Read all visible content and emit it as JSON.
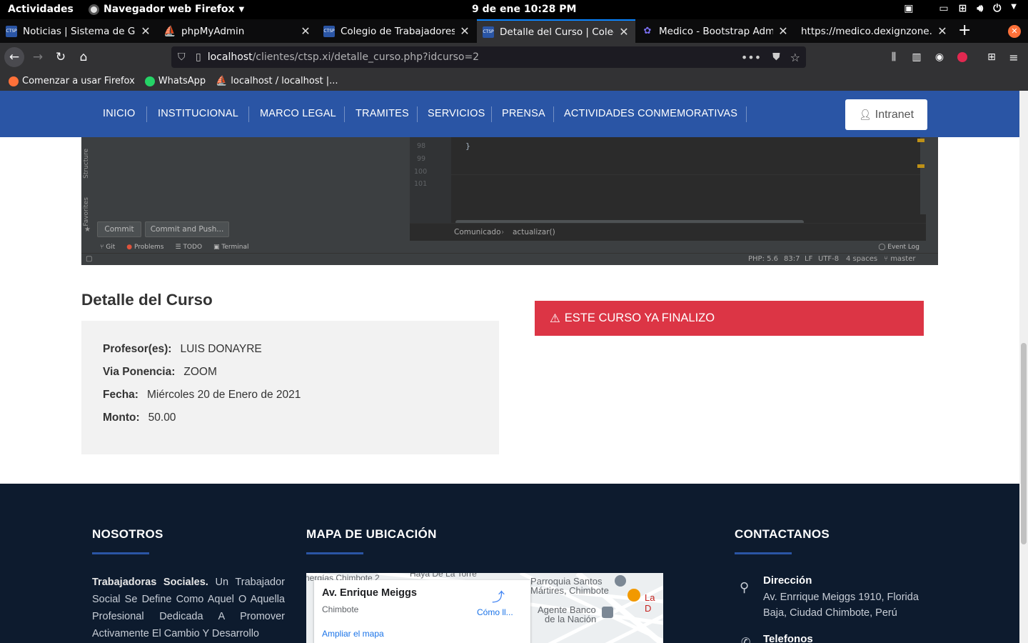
{
  "gnome": {
    "activities": "Actividades",
    "app_name": "Navegador web Firefox",
    "clock": "9 de ene  10:28 PM"
  },
  "tabs": [
    {
      "label": "Noticias | Sistema de Gesti",
      "favicon": "CTSP"
    },
    {
      "label": "phpMyAdmin",
      "favicon": "PMA"
    },
    {
      "label": "Colegio de Trabajadores So",
      "favicon": "CTSP"
    },
    {
      "label": "Detalle del Curso | Colegio",
      "favicon": "CTSP"
    },
    {
      "label": "Medico - Bootstrap Admin",
      "favicon": "DZ"
    },
    {
      "label": "https://medico.dexignzone.co",
      "favicon": ""
    }
  ],
  "url": {
    "host": "localhost",
    "path": "/clientes/ctsp.xi/detalle_curso.php?idcurso=2"
  },
  "bookmarks": [
    {
      "label": "Comenzar a usar Firefox"
    },
    {
      "label": "WhatsApp"
    },
    {
      "label": "localhost / localhost |..."
    }
  ],
  "site_nav": {
    "items": [
      "INICIO",
      "INSTITUCIONAL",
      "MARCO LEGAL",
      "TRAMITES",
      "SERVICIOS",
      "PRENSA",
      "ACTIVIDADES CONMEMORATIVAS"
    ],
    "intranet": "Intranet"
  },
  "ide": {
    "line_numbers": [
      "98",
      "99",
      "100",
      "101"
    ],
    "brace": "}",
    "side_tabs": [
      "Structure",
      "Favorites"
    ],
    "commit": "Commit",
    "commit_push": "Commit and Push...",
    "breadcrumb": [
      "Comunicado",
      "actualizar()"
    ],
    "tools": [
      "Git",
      "Problems",
      "TODO",
      "Terminal"
    ],
    "event_log": "Event Log",
    "status": [
      "PHP: 5.6",
      "83:7",
      "LF",
      "UTF-8",
      "4 spaces",
      "master"
    ]
  },
  "course": {
    "title": "Detalle del Curso",
    "fields": [
      {
        "label": "Profesor(es):",
        "value": "LUIS DONAYRE"
      },
      {
        "label": "Via Ponencia:",
        "value": "ZOOM"
      },
      {
        "label": "Fecha:",
        "value": "Miércoles 20 de Enero de 2021"
      },
      {
        "label": "Monto:",
        "value": "50.00"
      }
    ],
    "alert": "ESTE CURSO YA FINALIZO"
  },
  "footer": {
    "about_title": "NOSOTROS",
    "about_bold": "Trabajadoras Sociales.",
    "about_text": "Un Trabajador Social Se Define Como Aquel O Aquella Profesional Dedicada A Promover Activamente El Cambio Y Desarrollo",
    "map_title": "MAPA DE UBICACIÓN",
    "map": {
      "place": "Av. Enrique Meiggs",
      "city": "Chimbote",
      "directions": "Cómo ll...",
      "enlarge": "Ampliar el mapa",
      "labels": [
        "nergías Chimbote 2",
        "Haya De La Torre",
        "Parroquia Santos",
        "Mártires, Chimbote",
        "Agente Banco",
        "de la Nación",
        "La D"
      ]
    },
    "contact_title": "CONTACTANOS",
    "address_label": "Dirección",
    "address": "Av. Enrrique Meiggs 1910, Florida Baja, Ciudad Chimbote, Perú",
    "phones_label": "Telefonos"
  }
}
